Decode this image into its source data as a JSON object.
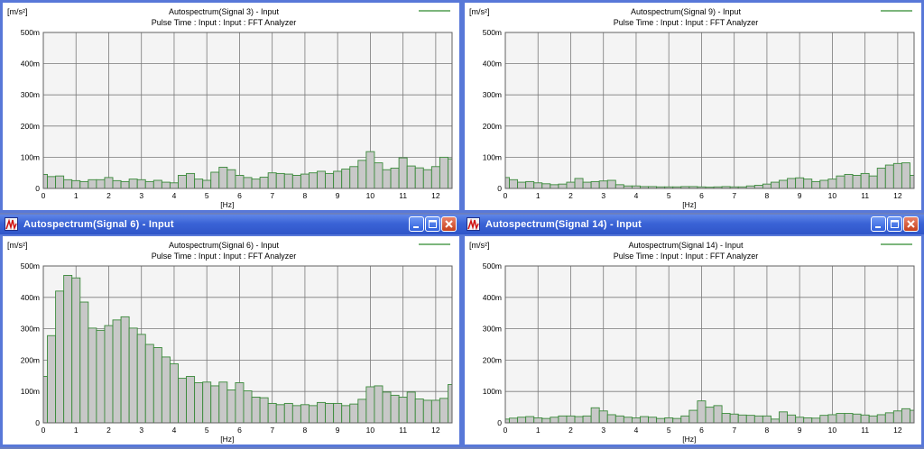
{
  "colors": {
    "bar_fill": "#c8c8c8",
    "bar_stroke": "#3a8a3a",
    "legend_line": "#2e8b2e",
    "plot_bg": "#f4f4f4",
    "title_bar": "#3a63d6"
  },
  "icons": {
    "window": "spectrum-icon",
    "minimize": "minimize-icon",
    "maximize": "maximize-icon",
    "close": "close-icon"
  },
  "windows": [
    {
      "window_title": "",
      "has_titlebar": false,
      "chart_title": "Autospectrum(Signal 3) - Input",
      "chart_subtitle": "Pulse Time : Input : Input : FFT Analyzer"
    },
    {
      "window_title": "",
      "has_titlebar": false,
      "chart_title": "Autospectrum(Signal 9) - Input",
      "chart_subtitle": "Pulse Time : Input : Input : FFT Analyzer"
    },
    {
      "window_title": "Autospectrum(Signal 6) - Input",
      "has_titlebar": true,
      "chart_title": "Autospectrum(Signal 6) - Input",
      "chart_subtitle": "Pulse Time : Input : Input : FFT Analyzer"
    },
    {
      "window_title": "Autospectrum(Signal 14) - Input",
      "has_titlebar": true,
      "chart_title": "Autospectrum(Signal 14) - Input",
      "chart_subtitle": "Pulse Time : Input : Input : FFT Analyzer"
    }
  ],
  "chart_data": [
    {
      "type": "bar",
      "title": "Autospectrum(Signal 3) - Input",
      "subtitle": "Pulse Time : Input : Input : FFT Analyzer",
      "xlabel": "[Hz]",
      "ylabel": "[m/s²]",
      "xlim": [
        0,
        12.5
      ],
      "ylim": [
        0,
        500
      ],
      "bin_width": 0.25,
      "x_ticks": [
        0,
        1,
        2,
        3,
        4,
        5,
        6,
        7,
        8,
        9,
        10,
        11,
        12
      ],
      "y_ticks": [
        {
          "v": 0,
          "label": "0"
        },
        {
          "v": 100,
          "label": "100m"
        },
        {
          "v": 200,
          "label": "200m"
        },
        {
          "v": 300,
          "label": "300m"
        },
        {
          "v": 400,
          "label": "400m"
        },
        {
          "v": 500,
          "label": "500m"
        }
      ],
      "grid": true,
      "legend": "top-right",
      "values": [
        45,
        38,
        40,
        28,
        25,
        22,
        28,
        28,
        35,
        25,
        22,
        30,
        28,
        22,
        26,
        20,
        18,
        42,
        48,
        30,
        26,
        52,
        68,
        60,
        42,
        35,
        30,
        36,
        50,
        48,
        46,
        42,
        46,
        50,
        55,
        48,
        55,
        62,
        70,
        90,
        118,
        82,
        60,
        65,
        98,
        72,
        66,
        60,
        70,
        100,
        95
      ]
    },
    {
      "type": "bar",
      "title": "Autospectrum(Signal 9) - Input",
      "subtitle": "Pulse Time : Input : Input : FFT Analyzer",
      "xlabel": "[Hz]",
      "ylabel": "[m/s²]",
      "xlim": [
        0,
        12.5
      ],
      "ylim": [
        0,
        500
      ],
      "bin_width": 0.25,
      "x_ticks": [
        0,
        1,
        2,
        3,
        4,
        5,
        6,
        7,
        8,
        9,
        10,
        11,
        12
      ],
      "y_ticks": [
        {
          "v": 0,
          "label": "0"
        },
        {
          "v": 100,
          "label": "100m"
        },
        {
          "v": 200,
          "label": "200m"
        },
        {
          "v": 300,
          "label": "300m"
        },
        {
          "v": 400,
          "label": "400m"
        },
        {
          "v": 500,
          "label": "500m"
        }
      ],
      "grid": true,
      "legend": "top-right",
      "values": [
        35,
        28,
        20,
        22,
        18,
        15,
        12,
        14,
        20,
        32,
        20,
        22,
        24,
        26,
        12,
        8,
        8,
        6,
        6,
        5,
        5,
        5,
        6,
        6,
        5,
        4,
        5,
        6,
        5,
        5,
        8,
        10,
        14,
        20,
        26,
        32,
        34,
        30,
        22,
        26,
        30,
        40,
        45,
        42,
        48,
        40,
        65,
        75,
        80,
        82,
        42
      ]
    },
    {
      "type": "bar",
      "title": "Autospectrum(Signal 6) - Input",
      "subtitle": "Pulse Time : Input : Input : FFT Analyzer",
      "xlabel": "[Hz]",
      "ylabel": "[m/s²]",
      "xlim": [
        0,
        12.5
      ],
      "ylim": [
        0,
        500
      ],
      "bin_width": 0.25,
      "x_ticks": [
        0,
        1,
        2,
        3,
        4,
        5,
        6,
        7,
        8,
        9,
        10,
        11,
        12
      ],
      "y_ticks": [
        {
          "v": 0,
          "label": "0"
        },
        {
          "v": 100,
          "label": "100m"
        },
        {
          "v": 200,
          "label": "200m"
        },
        {
          "v": 300,
          "label": "300m"
        },
        {
          "v": 400,
          "label": "400m"
        },
        {
          "v": 500,
          "label": "500m"
        }
      ],
      "grid": true,
      "legend": "top-right",
      "values": [
        148,
        278,
        420,
        470,
        462,
        385,
        302,
        295,
        310,
        328,
        338,
        302,
        282,
        250,
        240,
        210,
        188,
        142,
        148,
        128,
        130,
        118,
        130,
        105,
        128,
        102,
        82,
        80,
        62,
        58,
        62,
        55,
        58,
        55,
        65,
        62,
        62,
        55,
        60,
        75,
        115,
        118,
        98,
        88,
        82,
        98,
        76,
        72,
        72,
        78,
        122
      ]
    },
    {
      "type": "bar",
      "title": "Autospectrum(Signal 14) - Input",
      "subtitle": "Pulse Time : Input : Input : FFT Analyzer",
      "xlabel": "[Hz]",
      "ylabel": "[m/s²]",
      "xlim": [
        0,
        12.5
      ],
      "ylim": [
        0,
        500
      ],
      "bin_width": 0.25,
      "x_ticks": [
        0,
        1,
        2,
        3,
        4,
        5,
        6,
        7,
        8,
        9,
        10,
        11,
        12
      ],
      "y_ticks": [
        {
          "v": 0,
          "label": "0"
        },
        {
          "v": 100,
          "label": "100m"
        },
        {
          "v": 200,
          "label": "200m"
        },
        {
          "v": 300,
          "label": "300m"
        },
        {
          "v": 400,
          "label": "400m"
        },
        {
          "v": 500,
          "label": "500m"
        }
      ],
      "grid": true,
      "legend": "top-right",
      "values": [
        12,
        15,
        18,
        20,
        16,
        14,
        18,
        22,
        22,
        20,
        22,
        48,
        38,
        26,
        22,
        18,
        16,
        20,
        18,
        14,
        16,
        14,
        22,
        40,
        70,
        50,
        55,
        30,
        28,
        25,
        24,
        22,
        22,
        12,
        35,
        25,
        18,
        16,
        15,
        24,
        26,
        30,
        30,
        28,
        25,
        22,
        26,
        32,
        38,
        45,
        40
      ]
    }
  ]
}
